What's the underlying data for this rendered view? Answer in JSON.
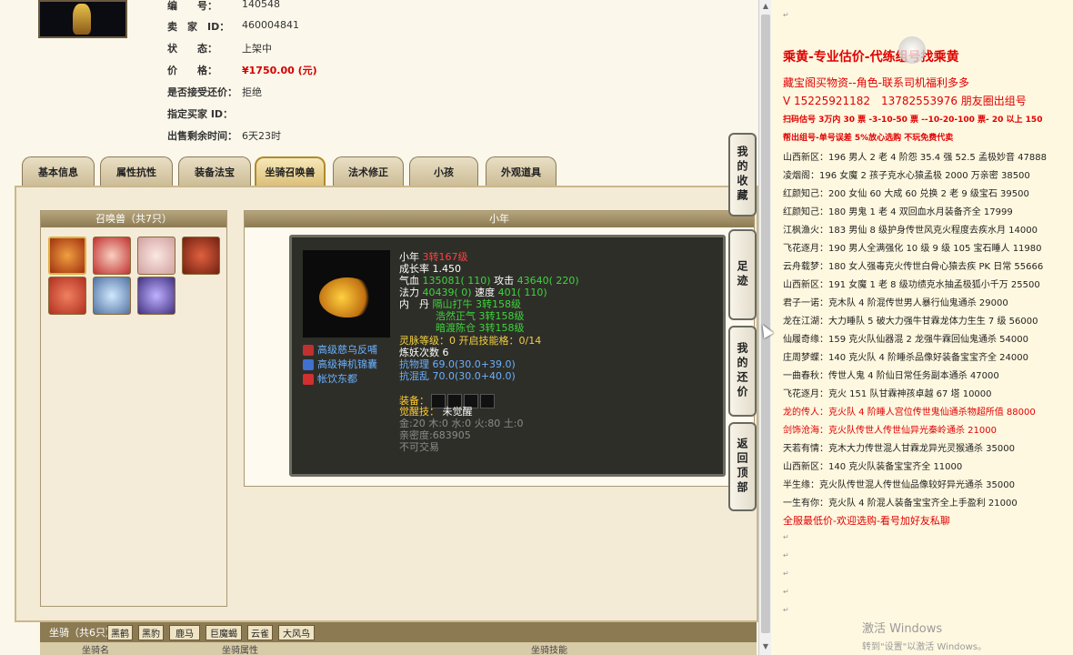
{
  "listing": {
    "id_label": "编　　号：",
    "id_value": "140548",
    "seller_label": "卖　家　ID：",
    "seller_value": "460004841",
    "status_label": "状　　态：",
    "status_value": "上架中",
    "price_label": "价　　格：",
    "price_value": "¥1750.00 (元)",
    "counter_label": "是否接受还价：",
    "counter_value": "拒绝",
    "buyer_label": "指定买家 ID：",
    "buyer_value": "",
    "remain_label": "出售剩余时间：",
    "remain_value": "6天23时"
  },
  "tabs": [
    "基本信息",
    "属性抗性",
    "装备法宝",
    "坐骑召唤兽",
    "法术修正",
    "小孩",
    "外观道具"
  ],
  "pets": {
    "title": "召唤兽（共7只）",
    "selected_title": "小年",
    "icons": [
      "pet-lion-icon",
      "pet-girl-icon",
      "pet-baby-icon",
      "pet-demon-icon",
      "pet-dragon-icon",
      "pet-ice-icon",
      "pet-spirit-icon"
    ]
  },
  "tooltip": {
    "name": "小年",
    "level": "3转167级",
    "growth": "成长率 1.450",
    "hp_label": "气血",
    "hp": "135081( 110)",
    "atk_label": "攻击",
    "atk": "43640( 220)",
    "mp_label": "法力",
    "mp": "40439( 0)",
    "spd_label": "速度",
    "spd": "401( 110)",
    "pill_label": "内　丹",
    "pill1": "隔山打牛 3转158级",
    "pill2": "浩然正气 3转158级",
    "pill3": "暗渡陈仓 3转158级",
    "spirit": "灵脉等级：0 开启技能格：0/14",
    "refine": "炼妖次数 6",
    "resist_phys": "抗物理 69.0(30.0+39.0)",
    "resist_chaos": "抗混乱 70.0(30.0+40.0)",
    "skills": [
      "高级慈乌反哺",
      "高级神机锦囊",
      "帐饮东都"
    ],
    "equip_label": "装备：",
    "awaken_label": "觉醒技：",
    "awaken_value": "未觉醒",
    "elements": "金:20 木:0 水:0 火:80 土:0",
    "intimacy": "亲密度:683905",
    "trade": "不可交易"
  },
  "mounts": {
    "title": "坐骑（共6只）",
    "tabs": [
      "黑鹤",
      "黑豹",
      "鹿马",
      "巨魔蝎",
      "云雀",
      "大风鸟"
    ],
    "col1": "坐骑名",
    "col2": "坐骑属性",
    "col3": "坐骑技能"
  },
  "sidenav": [
    "我的收藏",
    "足迹",
    "我的还价",
    "返回顶部"
  ],
  "right_panel": {
    "title": "乘黄-专业估价-代练组号找乘黄",
    "line1": "藏宝阁买物资--角色-联系司机福利多多",
    "line2": "V 15225921182　13782553976 朋友圈出组号",
    "line3": "扫码估号 3万内 30 票 -3-10-50 票 --10-20-100 票- 20 以上 150",
    "line4": "帮出组号-单号误差 5%放心选购 不玩免费代卖",
    "entries": [
      "山西新区：196 男人 2 老 4 阶怨 35.4 强 52.5 孟极妙音 47888",
      "凌烟阁：196 女魔 2 孩子克水心猿孟极 2000 万亲密 38500",
      "红颜知己：200 女仙 60 大成 60 兑换 2 老 9 级宝石 39500",
      "红颜知己：180 男鬼 1 老 4 双回血水月装备齐全 17999",
      "江枫渔火：183 男仙 8 级护身传世风克火程度去疾水月 14000",
      "飞花逐月：190 男人全满强化 10 级 9 级 105 宝石睡人 11980",
      "云舟载梦：180 女人强毒克火传世白骨心猿去疾 PK 日常 55666",
      "山西新区：191 女魔 1 老 8 级功绩克水抽孟极狐小千万 25500",
      "君子一诺：克木队 4 阶混传世男人暴行仙鬼通杀 29000",
      "龙在江湖：大力睡队 5 破大力强牛甘霖龙体力生生 7 级 56000",
      "仙履奇缘：159 克火队仙器混 2 龙强牛霖回仙鬼通杀 54000",
      "庄周梦蝶：140 克火队 4 阶睡杀品像好装备宝宝齐全 24000",
      "一曲春秋：传世人鬼 4 阶仙日常任务副本通杀 47000",
      "飞花逐月：克火 151 队甘霖神孩卓越 67 塔 10000"
    ],
    "red_entry1": "龙的传人：克火队 4 阶睡人宫位传世鬼仙通杀物超所值 88000",
    "red_entry2": "剑饰沧海：克火队传世人传世仙异光秦岭通杀 21000",
    "entries2": [
      "天若有情：克木大力传世混人甘霖龙异光灵猴通杀 35000",
      "山西新区：140 克火队装备宝宝齐全 11000",
      "半生缘：克火队传世混人传世仙品像较好异光通杀 35000",
      "一生有你：克火队 4 阶混人装备宝宝齐全上手盈利 21000"
    ],
    "footer": "全服最低价-欢迎选购-看号加好友私聊",
    "overlay_logo": "",
    "watermark1": "激活 Windows",
    "watermark2": "转到\"设置\"以激活 Windows。"
  },
  "colors": {
    "accent_red": "#e00000",
    "tab_active": "#dcc07a",
    "tooltip_bg": "#2e2e28",
    "stat_green": "#3ed43e",
    "right_bg": "#fff8e0"
  }
}
